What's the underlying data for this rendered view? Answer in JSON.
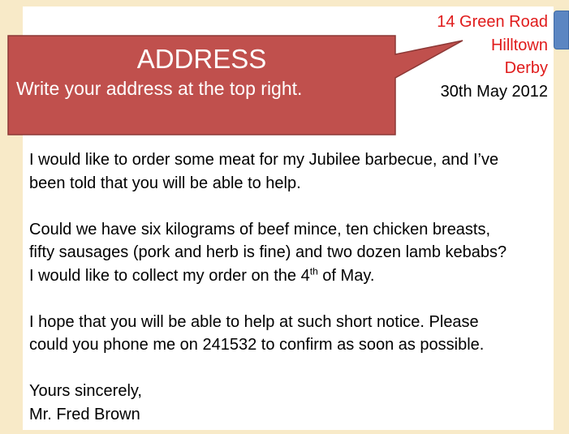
{
  "address": {
    "line1": "14 Green Road",
    "line2": "Hilltown",
    "line3": "Derby",
    "date": "30th May 2012"
  },
  "callout": {
    "title": "ADDRESS",
    "subtitle": "Write your address at the top right."
  },
  "letter": {
    "paragraph1": {
      "line1": "I would like to order some meat for my Jubilee barbecue, and I’ve",
      "line2": "been told that you will be able to help."
    },
    "paragraph2": {
      "line1": "Could we have six kilograms of beef mince, ten chicken breasts,",
      "line2": "fifty sausages (pork and herb is fine) and two dozen lamb kebabs?",
      "line3_prefix": "I would like to collect my order on the 4",
      "line3_superscript": "th",
      "line3_suffix": " of May."
    },
    "paragraph3": {
      "line1": "I hope that you will be able to help at such short notice. Please",
      "line2": "could you phone me on 241532 to confirm as soon as possible."
    },
    "closing": "Yours sincerely,",
    "signature": "Mr. Fred Brown"
  },
  "colors": {
    "background": "#f8eac8",
    "page": "#ffffff",
    "address_text": "#e01b1b",
    "callout_fill": "#c0504d",
    "callout_border": "#8c3836",
    "callout_text": "#ffffff",
    "side_tab": "#5b86c2"
  }
}
